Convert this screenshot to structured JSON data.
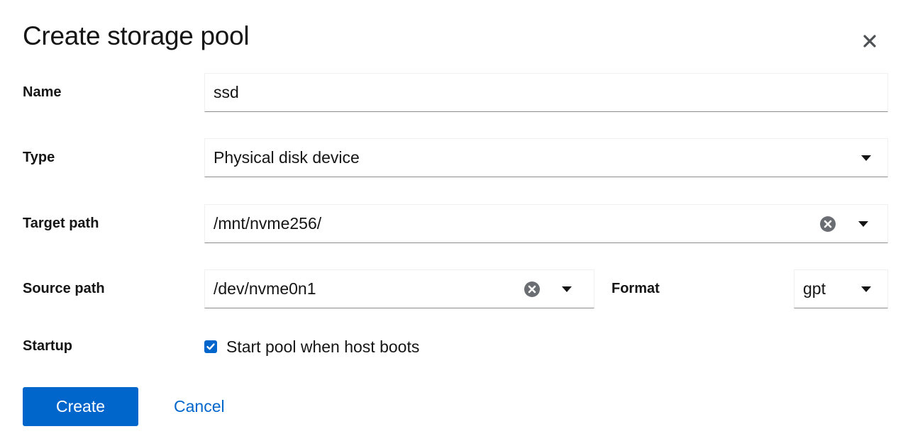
{
  "dialog": {
    "title": "Create storage pool",
    "close_icon": "close-icon"
  },
  "form": {
    "name": {
      "label": "Name",
      "value": "ssd"
    },
    "type": {
      "label": "Type",
      "value": "Physical disk device",
      "icon": "caret-down-icon"
    },
    "target_path": {
      "label": "Target path",
      "value": "/mnt/nvme256/",
      "clear_icon": "clear-circle-icon",
      "icon": "caret-down-icon"
    },
    "source_path": {
      "label": "Source path",
      "value": "/dev/nvme0n1",
      "clear_icon": "clear-circle-icon",
      "icon": "caret-down-icon"
    },
    "format": {
      "label": "Format",
      "value": "gpt",
      "icon": "caret-down-icon"
    },
    "startup": {
      "label": "Startup",
      "checkbox_label": "Start pool when host boots",
      "checked": true
    }
  },
  "actions": {
    "create_label": "Create",
    "cancel_label": "Cancel"
  },
  "colors": {
    "primary": "#0066cc",
    "text": "#151515",
    "clear_icon": "#6a6e73"
  }
}
